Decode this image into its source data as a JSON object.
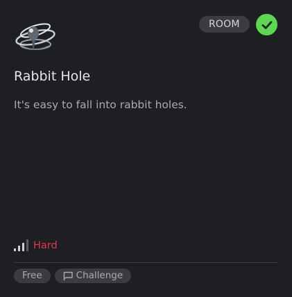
{
  "room": {
    "type_badge": "ROOM",
    "completed": true,
    "title": "Rabbit Hole",
    "description": "It's easy to fall into rabbit holes.",
    "difficulty": "Hard",
    "difficulty_color": "#e73949",
    "tags": [
      "Free",
      "Challenge"
    ],
    "icons": {
      "logo": "rabbit-hole-logo",
      "completed": "check-icon",
      "difficulty": "signal-bars-icon",
      "challenge": "flag-icon"
    }
  }
}
